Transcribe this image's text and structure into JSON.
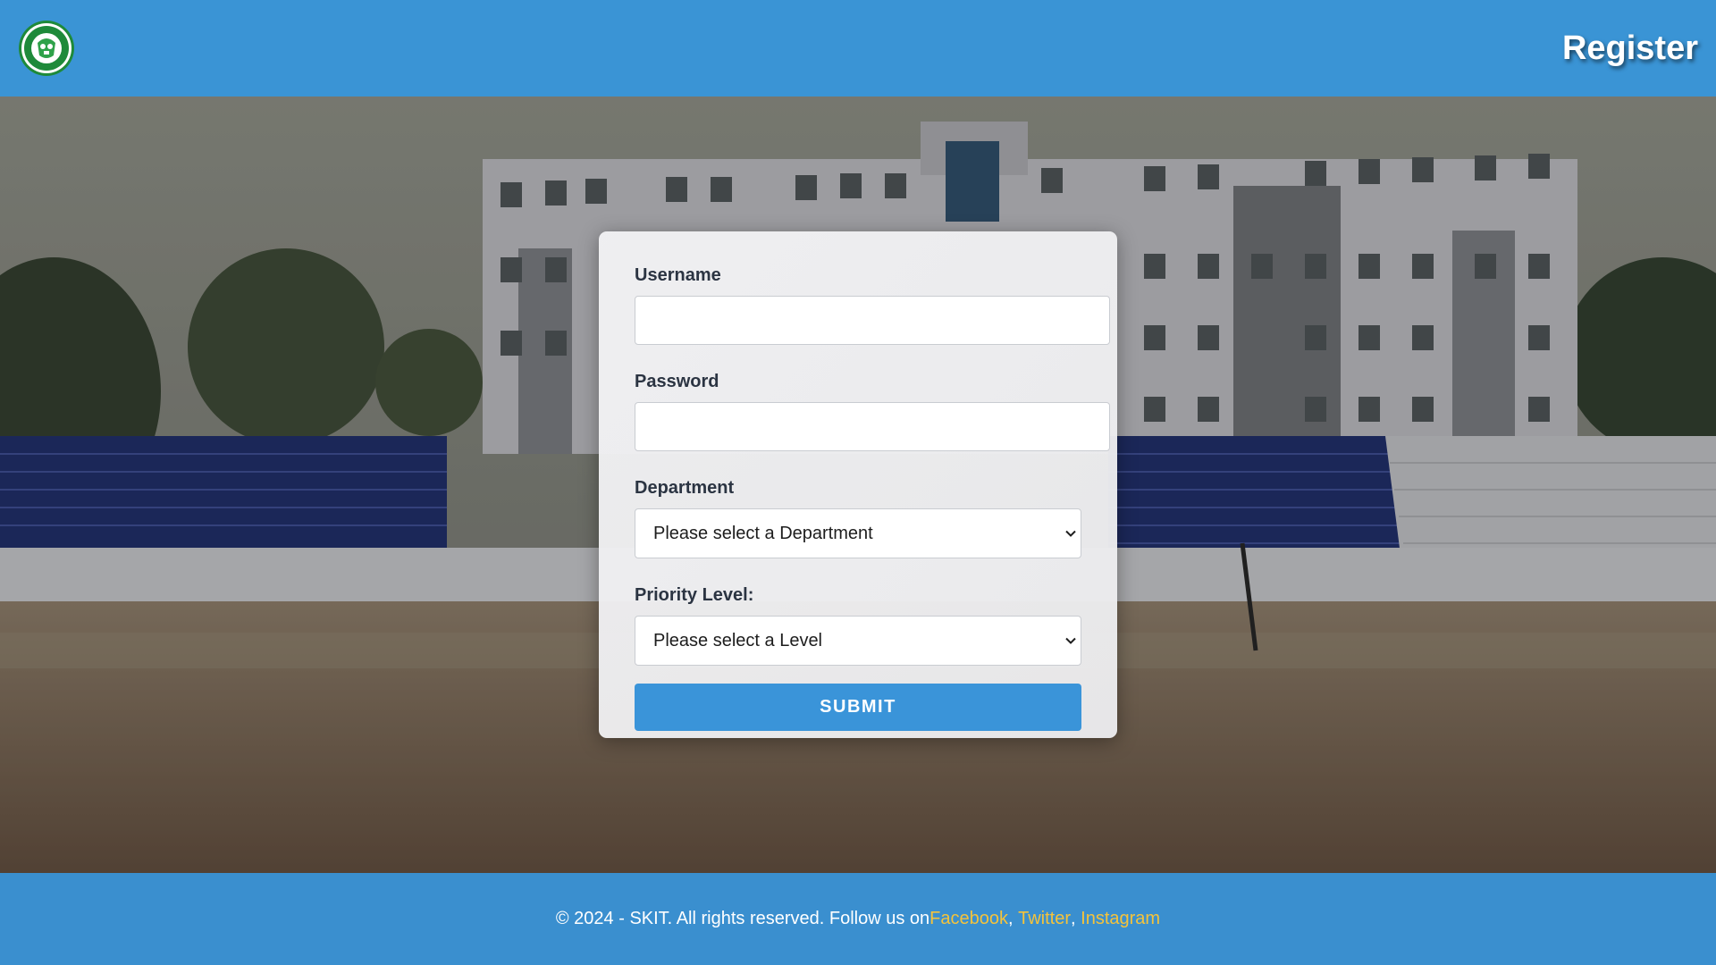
{
  "header": {
    "logo_icon": "college-seal-logo-icon",
    "register_label": "Register"
  },
  "form": {
    "username_label": "Username",
    "username_value": "",
    "password_label": "Password",
    "password_value": "",
    "department_label": "Department",
    "department_selected": "Please select a Department",
    "priority_label": "Priority Level:",
    "priority_selected": "Please select a Level",
    "submit_label": "SUBMIT"
  },
  "footer": {
    "copyright": "© 2024 - SKIT. All rights reserved. Follow us on ",
    "links": [
      {
        "label": "Facebook"
      },
      {
        "label": "Twitter"
      },
      {
        "label": "Instagram"
      }
    ],
    "separator": ", "
  },
  "colors": {
    "header_bg": "#3a94d5",
    "footer_bg": "#3a8fcf",
    "submit_bg": "#3a94d9",
    "footer_link": "#f5c33b"
  }
}
